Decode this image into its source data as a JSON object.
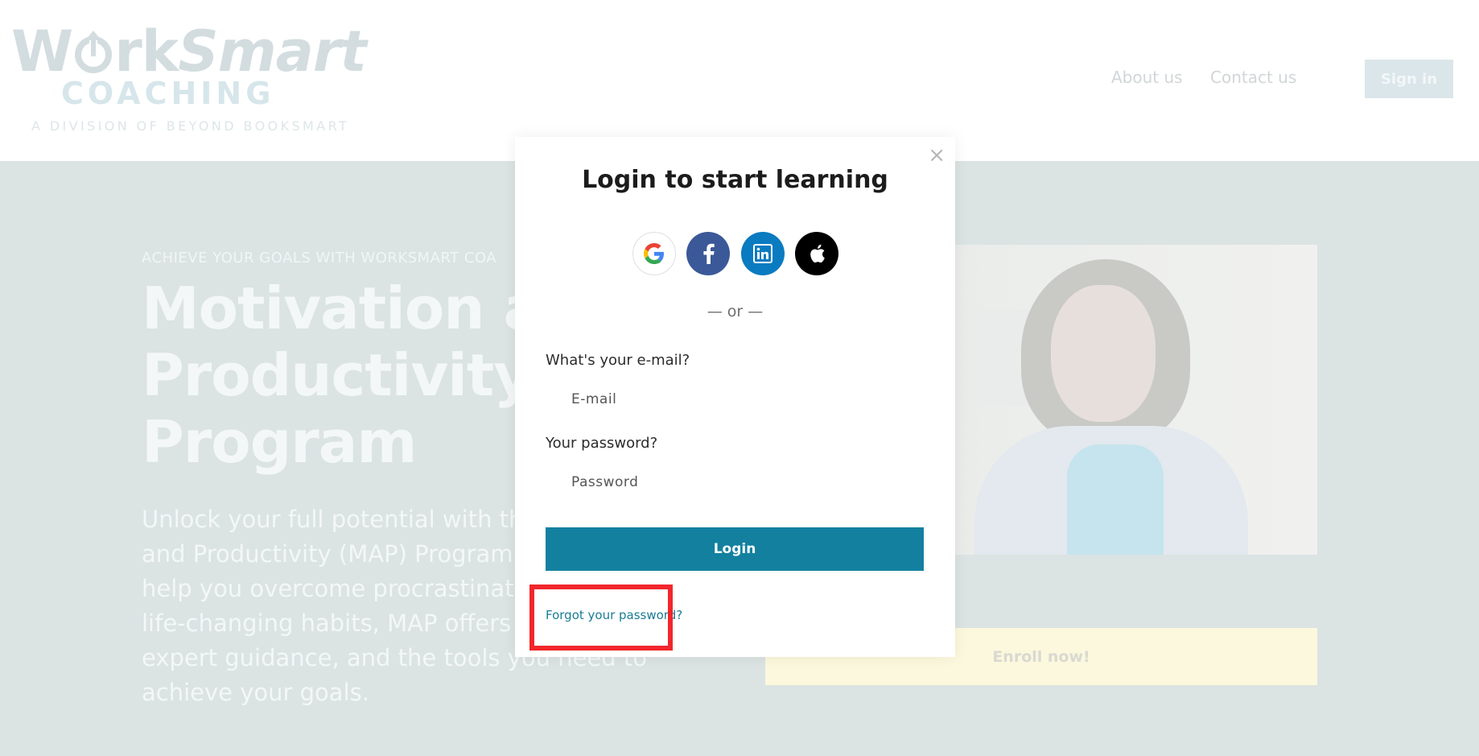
{
  "header": {
    "logo": {
      "main_prefix": "W",
      "main_rk": "rk",
      "main_smart": "Smart",
      "sub": "COACHING",
      "tagline": "A DIVISION OF BEYOND BOOKSMART"
    },
    "nav": {
      "about": "About us",
      "contact": "Contact us"
    },
    "signin_label": "Sign in"
  },
  "hero": {
    "eyebrow": "ACHIEVE YOUR GOALS WITH WORKSMART COA",
    "title_line1": "Motivation ar",
    "title_line2": "Productivity",
    "title_line3": "Program",
    "desc_line1": "Unlock your full potential with the",
    "desc_line2": "and Productivity (MAP) Program.",
    "desc_line3": "help you overcome procrastinatio",
    "desc_line4": "life-changing habits, MAP offers",
    "desc_line5": "expert guidance, and the tools you need to",
    "desc_line6": "achieve your goals.",
    "enroll_label": "Enroll now!"
  },
  "modal": {
    "close_glyph": "×",
    "title": "Login to start learning",
    "social": [
      {
        "name": "google",
        "icon": "google-icon"
      },
      {
        "name": "facebook",
        "icon": "facebook-icon"
      },
      {
        "name": "linkedin",
        "icon": "linkedin-icon"
      },
      {
        "name": "apple",
        "icon": "apple-icon"
      }
    ],
    "or_text": "— or —",
    "email_label": "What's your e-mail?",
    "email_placeholder": "E-mail",
    "email_value": "",
    "password_label": "Your password?",
    "password_placeholder": "Password",
    "password_value": "",
    "login_label": "Login",
    "forgot_label": "Forgot your password?"
  },
  "colors": {
    "primary_button": "#13809f",
    "link": "#1a7d94",
    "highlight": "#f2262c",
    "facebook": "#3b5998",
    "linkedin": "#0a7bc0",
    "apple": "#000000"
  }
}
